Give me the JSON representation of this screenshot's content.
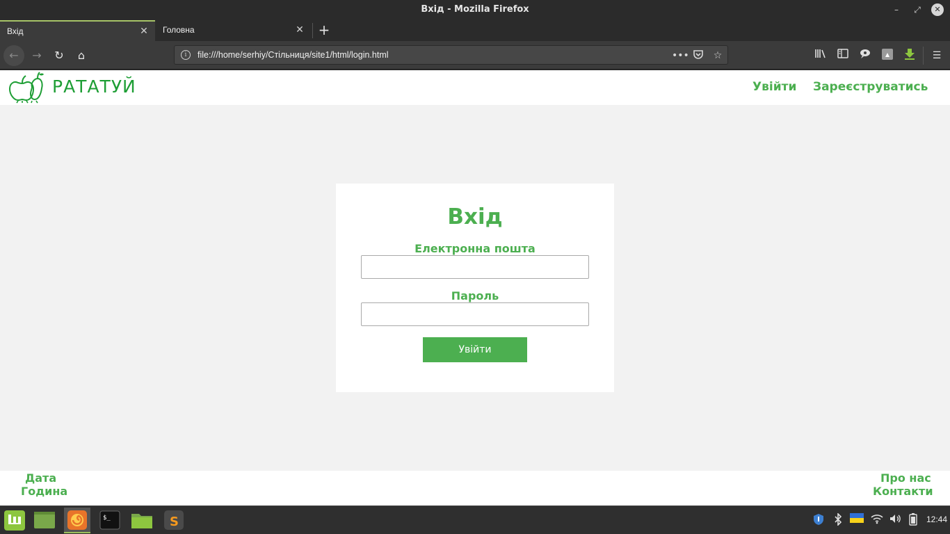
{
  "window": {
    "title": "Вхід - Mozilla Firefox"
  },
  "tabs": [
    {
      "label": "Вхід",
      "active": true
    },
    {
      "label": "Головна",
      "active": false
    }
  ],
  "urlbar": {
    "url": "file:///home/serhiy/Стільниця/site1/html/login.html"
  },
  "site": {
    "brand": "РАТАТУЙ",
    "nav": {
      "login": "Увійти",
      "register": "Зареєструватись"
    }
  },
  "login_form": {
    "title": "Вхід",
    "email_label": "Електронна пошта",
    "email_value": "",
    "password_label": "Пароль",
    "password_value": "",
    "submit_label": "Увійти"
  },
  "footer": {
    "left": [
      "Дата",
      "Година"
    ],
    "right": [
      "Про нас",
      "Контакти"
    ]
  },
  "taskbar": {
    "clock": "12:44"
  },
  "colors": {
    "brand_green": "#1e9e35",
    "accent_green": "#4caf50",
    "page_bg": "#f2f2f2"
  },
  "icons": {
    "nav": [
      "back-icon",
      "forward-icon",
      "reload-icon",
      "home-icon"
    ],
    "url_actions": [
      "more-actions-icon",
      "pocket-icon",
      "bookmark-star-icon"
    ],
    "toolbar": [
      "library-icon",
      "sidebar-icon",
      "extension-icon",
      "screenshot-icon",
      "download-icon",
      "menu-icon"
    ]
  }
}
